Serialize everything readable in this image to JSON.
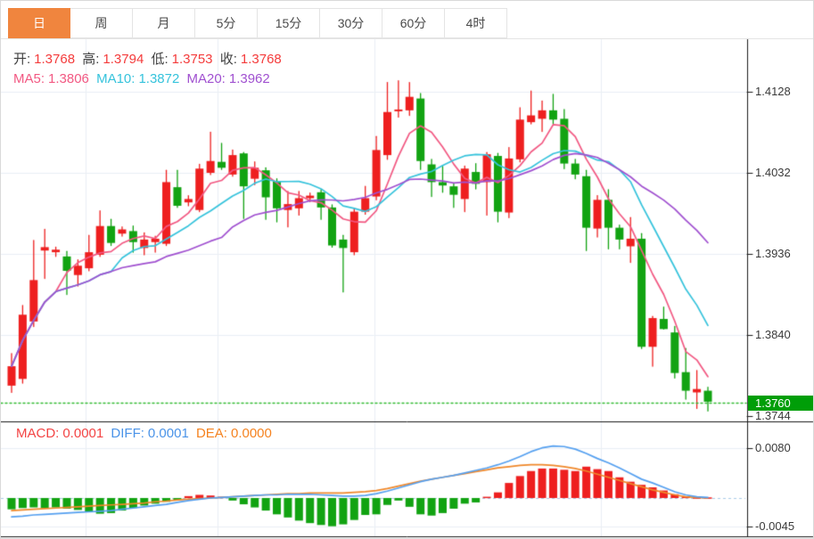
{
  "tabs": [
    {
      "label": "日",
      "active": true
    },
    {
      "label": "周",
      "active": false
    },
    {
      "label": "月",
      "active": false
    },
    {
      "label": "5分",
      "active": false
    },
    {
      "label": "15分",
      "active": false
    },
    {
      "label": "30分",
      "active": false
    },
    {
      "label": "60分",
      "active": false
    },
    {
      "label": "4时",
      "active": false
    }
  ],
  "ohlc_row": {
    "open_label": "开:",
    "open": "1.3768",
    "high_label": "高:",
    "high": "1.3794",
    "low_label": "低:",
    "low": "1.3753",
    "close_label": "收:",
    "close": "1.3768"
  },
  "ma_row": {
    "ma5_label": "MA5:",
    "ma5": "1.3806",
    "ma10_label": "MA10:",
    "ma10": "1.3872",
    "ma20_label": "MA20:",
    "ma20": "1.3962"
  },
  "macd_row": {
    "macd_label": "MACD:",
    "macd": "0.0001",
    "diff_label": "DIFF:",
    "diff": "0.0001",
    "dea_label": "DEA:",
    "dea": "0.0000"
  },
  "price_axis": {
    "labels": [
      "1.4128",
      "1.4032",
      "1.3936",
      "1.3840",
      "1.3744"
    ],
    "current_badge": "1.3760"
  },
  "macd_axis": {
    "labels": [
      "0.0080",
      "-0.0045"
    ]
  },
  "colors": {
    "accent_tab": "#f0853e",
    "up": "#ee1f1f",
    "down": "#12a312",
    "ohlc_value": "#f43b3b",
    "label_dark": "#3f3f3f",
    "ma5": "#f25882",
    "ma10": "#35c3dc",
    "ma20": "#a050d0",
    "macd_label": "#f34444",
    "diff_label": "#4a93e8",
    "dea_label": "#f5821f",
    "dif_line": "#55a0f0",
    "dea_line": "#f0882a",
    "badge_bg": "#009e08",
    "current_line": "#33bb33",
    "grid": "#e9eef5",
    "axis_line": "#1a1a1a"
  },
  "chart_data": {
    "type": "candlestick+macd",
    "price_axis_ticks": [
      1.4128,
      1.4032,
      1.3936,
      1.384,
      1.3744
    ],
    "macd_axis_ticks": [
      0.008,
      -0.0045
    ],
    "current_price": 1.376,
    "candles": [
      [
        1.378,
        1.3818,
        1.3772,
        1.3803
      ],
      [
        1.3788,
        1.3875,
        1.3783,
        1.3864
      ],
      [
        1.3856,
        1.3952,
        1.385,
        1.3905
      ],
      [
        1.394,
        1.3965,
        1.3907,
        1.3944
      ],
      [
        1.3938,
        1.3944,
        1.3933,
        1.3941
      ],
      [
        1.3933,
        1.3939,
        1.3888,
        1.3916
      ],
      [
        1.3911,
        1.3929,
        1.3898,
        1.3922
      ],
      [
        1.3919,
        1.3958,
        1.3916,
        1.3938
      ],
      [
        1.3935,
        1.3987,
        1.3933,
        1.3969
      ],
      [
        1.3969,
        1.3977,
        1.3946,
        1.3949
      ],
      [
        1.396,
        1.3968,
        1.3957,
        1.3965
      ],
      [
        1.3963,
        1.3969,
        1.3938,
        1.395
      ],
      [
        1.3943,
        1.3961,
        1.3935,
        1.3953
      ],
      [
        1.395,
        1.3957,
        1.3938,
        1.3954
      ],
      [
        1.3948,
        1.4035,
        1.3946,
        1.4021
      ],
      [
        1.4015,
        1.4035,
        1.3991,
        1.3993
      ],
      [
        1.3997,
        1.4005,
        1.3993,
        1.4001
      ],
      [
        1.3988,
        1.4042,
        1.3986,
        1.4037
      ],
      [
        1.4032,
        1.408,
        1.403,
        1.4046
      ],
      [
        1.4045,
        1.4067,
        1.4036,
        1.4038
      ],
      [
        1.403,
        1.4059,
        1.4028,
        1.4053
      ],
      [
        1.4055,
        1.4056,
        1.3978,
        1.4016
      ],
      [
        1.4025,
        1.4045,
        1.4018,
        1.4038
      ],
      [
        1.4035,
        1.4038,
        1.3977,
        1.4003
      ],
      [
        1.4022,
        1.4025,
        1.3974,
        1.399
      ],
      [
        1.3988,
        1.401,
        1.3968,
        1.3995
      ],
      [
        1.399,
        1.401,
        1.3982,
        1.4002
      ],
      [
        1.4002,
        1.4008,
        1.3998,
        1.4005
      ],
      [
        1.4009,
        1.4012,
        1.3977,
        1.3991
      ],
      [
        1.3991,
        1.3994,
        1.3944,
        1.3946
      ],
      [
        1.3953,
        1.3958,
        1.3891,
        1.3943
      ],
      [
        1.3938,
        1.399,
        1.3935,
        1.3986
      ],
      [
        1.3986,
        1.4016,
        1.3983,
        1.4002
      ],
      [
        1.4004,
        1.4075,
        1.4,
        1.4059
      ],
      [
        1.4053,
        1.4139,
        1.4048,
        1.4104
      ],
      [
        1.4105,
        1.4141,
        1.4098,
        1.4107
      ],
      [
        1.4106,
        1.4139,
        1.41,
        1.4122
      ],
      [
        1.412,
        1.4126,
        1.4036,
        1.4046
      ],
      [
        1.4042,
        1.4048,
        1.4004,
        1.4021
      ],
      [
        1.4021,
        1.404,
        1.4009,
        1.4017
      ],
      [
        1.4016,
        1.402,
        1.3991,
        1.4006
      ],
      [
        1.4001,
        1.404,
        1.3986,
        1.4037
      ],
      [
        1.4033,
        1.4043,
        1.4013,
        1.4019
      ],
      [
        1.4021,
        1.4056,
        1.3982,
        1.4054
      ],
      [
        1.4052,
        1.4055,
        1.3974,
        1.3986
      ],
      [
        1.3985,
        1.4062,
        1.3979,
        1.4049
      ],
      [
        1.4048,
        1.4109,
        1.4045,
        1.4095
      ],
      [
        1.4092,
        1.4129,
        1.409,
        1.41
      ],
      [
        1.4096,
        1.4117,
        1.4081,
        1.4106
      ],
      [
        1.4106,
        1.4125,
        1.409,
        1.4095
      ],
      [
        1.4096,
        1.4107,
        1.4037,
        1.4043
      ],
      [
        1.4043,
        1.4048,
        1.4025,
        1.403
      ],
      [
        1.4028,
        1.4035,
        1.394,
        1.3967
      ],
      [
        1.3966,
        1.4005,
        1.3956,
        1.4
      ],
      [
        1.4,
        1.4012,
        1.3942,
        1.3967
      ],
      [
        1.3967,
        1.397,
        1.3942,
        1.3953
      ],
      [
        1.3945,
        1.3979,
        1.3926,
        1.3954
      ],
      [
        1.3954,
        1.396,
        1.3824,
        1.3826
      ],
      [
        1.3826,
        1.3862,
        1.3803,
        1.386
      ],
      [
        1.3859,
        1.3873,
        1.3847,
        1.3847
      ],
      [
        1.3843,
        1.385,
        1.3789,
        1.3795
      ],
      [
        1.3796,
        1.3824,
        1.3764,
        1.3774
      ],
      [
        1.3772,
        1.3798,
        1.3753,
        1.3776
      ],
      [
        1.3774,
        1.3778,
        1.375,
        1.3761
      ]
    ],
    "ma_windows": [
      5,
      10,
      20
    ],
    "macd": {
      "hist": [
        -0.0018,
        -0.0016,
        -0.0015,
        -0.0016,
        -0.0015,
        -0.0017,
        -0.0019,
        -0.0022,
        -0.0025,
        -0.0024,
        -0.002,
        -0.0016,
        -0.0012,
        -0.0009,
        -0.0006,
        -0.0003,
        0.0003,
        0.0005,
        0.0004,
        0.0002,
        -0.0004,
        -0.001,
        -0.0015,
        -0.002,
        -0.0026,
        -0.0031,
        -0.0036,
        -0.004,
        -0.0043,
        -0.0045,
        -0.0042,
        -0.0035,
        -0.0027,
        -0.0026,
        -0.0011,
        -0.0004,
        -0.0014,
        -0.0026,
        -0.0028,
        -0.0024,
        -0.0017,
        -0.0009,
        -0.0007,
        0.0002,
        0.0009,
        0.0024,
        0.0035,
        0.0043,
        0.0047,
        0.0047,
        0.0045,
        0.0043,
        0.005,
        0.0046,
        0.0043,
        0.0033,
        0.0026,
        0.0021,
        0.0017,
        0.0012,
        0.0006,
        0.0002,
        0.0001,
        0.0001
      ],
      "dif": [
        -0.003,
        -0.0029,
        -0.0027,
        -0.0026,
        -0.0025,
        -0.0024,
        -0.0023,
        -0.0022,
        -0.0021,
        -0.002,
        -0.0018,
        -0.0016,
        -0.0014,
        -0.0012,
        -0.001,
        -0.0007,
        -0.0004,
        -0.0002,
        0.0,
        0.0001,
        0.0002,
        0.0003,
        0.0004,
        0.0005,
        0.0005,
        0.0006,
        0.0006,
        0.0006,
        0.0005,
        0.0004,
        0.0003,
        0.0003,
        0.0004,
        0.0007,
        0.0011,
        0.0016,
        0.0021,
        0.0026,
        0.003,
        0.0033,
        0.0036,
        0.004,
        0.0044,
        0.0048,
        0.0053,
        0.0059,
        0.0066,
        0.0074,
        0.008,
        0.0083,
        0.0082,
        0.0078,
        0.0071,
        0.0063,
        0.0056,
        0.0048,
        0.0039,
        0.003,
        0.0024,
        0.0017,
        0.001,
        0.0005,
        0.0002,
        0.0001
      ],
      "dea": [
        -0.002,
        -0.0019,
        -0.0018,
        -0.0017,
        -0.0016,
        -0.0015,
        -0.0014,
        -0.0013,
        -0.0012,
        -0.0011,
        -0.001,
        -0.0009,
        -0.0008,
        -0.0006,
        -0.0005,
        -0.0003,
        -0.0002,
        -0.0001,
        0.0,
        0.0001,
        0.0002,
        0.0003,
        0.0004,
        0.0005,
        0.0006,
        0.0007,
        0.0007,
        0.0008,
        0.0008,
        0.0008,
        0.0008,
        0.0009,
        0.001,
        0.0012,
        0.0015,
        0.0019,
        0.0023,
        0.0027,
        0.003,
        0.0033,
        0.0036,
        0.0039,
        0.0042,
        0.0045,
        0.0048,
        0.005,
        0.0052,
        0.0053,
        0.0053,
        0.0052,
        0.005,
        0.0047,
        0.0043,
        0.0038,
        0.0033,
        0.0028,
        0.0023,
        0.0018,
        0.0013,
        0.0009,
        0.0005,
        0.0002,
        0.0001,
        0.0
      ]
    }
  }
}
